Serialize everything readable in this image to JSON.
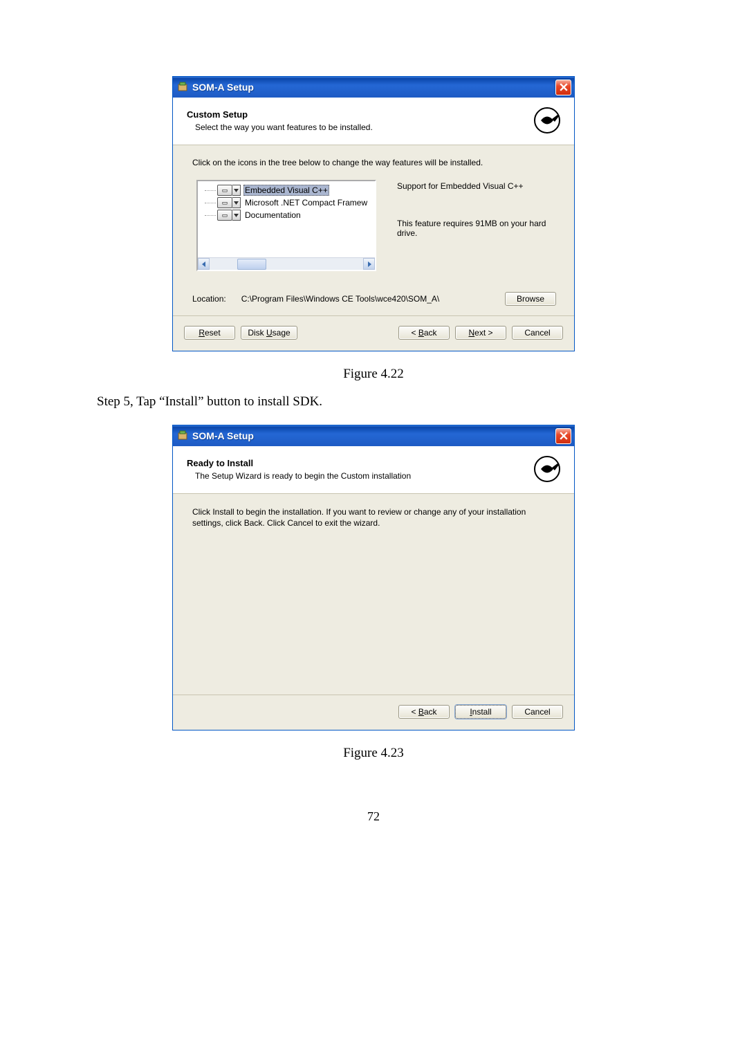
{
  "dialog1": {
    "title": "SOM-A Setup",
    "header_title": "Custom Setup",
    "header_subtitle": "Select the way you want features to be installed.",
    "instruction": "Click on the icons in the tree below to change the way features will be installed.",
    "tree": {
      "items": [
        {
          "label": "Embedded Visual C++",
          "selected": true
        },
        {
          "label": "Microsoft .NET Compact Framew",
          "selected": false
        },
        {
          "label": "Documentation",
          "selected": false
        }
      ]
    },
    "desc_title": "Support for Embedded Visual C++",
    "desc_req": "This feature requires 91MB on your hard drive.",
    "location_label": "Location:",
    "location_path": "C:\\Program Files\\Windows CE Tools\\wce420\\SOM_A\\",
    "browse_label": "Browse",
    "buttons": {
      "reset": "Reset",
      "disk_usage": "Disk Usage",
      "back": "< Back",
      "next": "Next >",
      "cancel": "Cancel"
    }
  },
  "figure1_caption": "Figure 4.22",
  "step_text": "Step 5, Tap “Install” button to install SDK.",
  "dialog2": {
    "title": "SOM-A Setup",
    "header_title": "Ready to Install",
    "header_subtitle": "The Setup Wizard is ready to begin the Custom installation",
    "body": "Click Install to begin the installation.  If you want to review or change any of your installation settings, click Back.  Click Cancel to exit the wizard.",
    "buttons": {
      "back": "< Back",
      "install": "Install",
      "cancel": "Cancel"
    }
  },
  "figure2_caption": "Figure 4.23",
  "page_number": "72"
}
